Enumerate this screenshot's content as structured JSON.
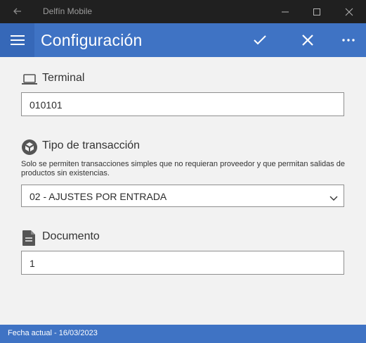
{
  "window": {
    "title": "Delfín Mobile",
    "back_icon": "arrow-left-icon",
    "minimize_icon": "minimize-icon",
    "maximize_icon": "maximize-icon",
    "close_icon": "close-icon"
  },
  "appbar": {
    "title": "Configuración",
    "menu_icon": "hamburger-menu-icon",
    "accept_icon": "checkmark-icon",
    "cancel_icon": "close-x-icon",
    "more_icon": "more-ellipsis-icon",
    "color": "#3f73c4"
  },
  "terminal": {
    "label": "Terminal",
    "icon": "laptop-icon",
    "value": "010101"
  },
  "transaction": {
    "label": "Tipo de transacción",
    "icon": "boxes-icon",
    "description": "Solo se permiten transacciones simples que no requieran proveedor  y que permitan salidas de productos sin existencias.",
    "selected": "02 - AJUSTES POR ENTRADA"
  },
  "document": {
    "label": "Documento",
    "icon": "document-icon",
    "value": "1"
  },
  "status": {
    "text": "Fecha actual - 16/03/2023"
  }
}
